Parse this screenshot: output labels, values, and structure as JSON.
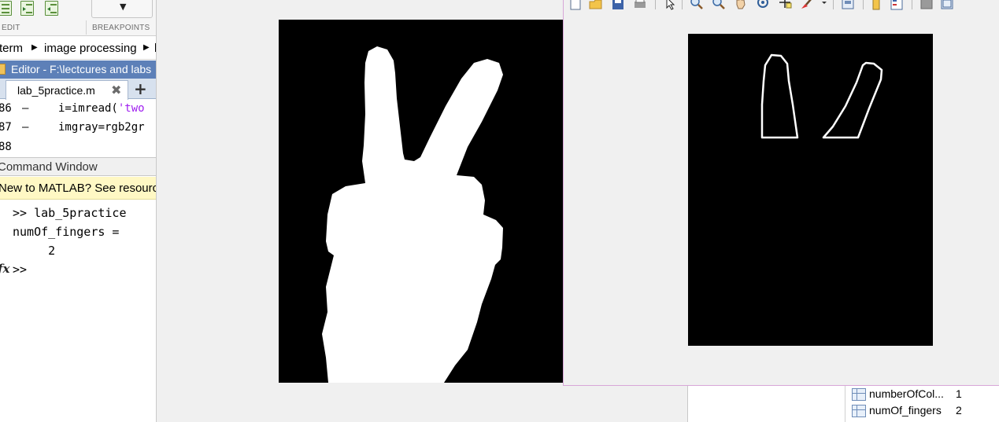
{
  "toolstrip": {
    "section_edit": "EDIT",
    "section_breakpoints": "BREAKPOINTS",
    "breakpoints_icon": "chevron-down-icon"
  },
  "address_bar": {
    "crumbs": [
      "term",
      "image processing",
      "labs"
    ]
  },
  "editor": {
    "title": "Editor - F:\\lectcures and labs",
    "tab_label": "lab_5practice.m",
    "tab_close": "✖",
    "add_tab": "+",
    "lines": [
      {
        "num": "86",
        "dash": "–",
        "code": "i=imread(",
        "str": "'two"
      },
      {
        "num": "87",
        "dash": "–",
        "code": "imgray=rgb2gr",
        "str": ""
      },
      {
        "num": "88",
        "dash": "",
        "code": "",
        "str": ""
      }
    ]
  },
  "command_window": {
    "title": "Command Window",
    "banner": "New to MATLAB? See resources",
    "output": [
      ">> lab_5practice",
      "numOf_fingers =",
      "     2",
      ">>"
    ],
    "fx_symbol": "fx"
  },
  "workspace": {
    "variables": [
      {
        "name": "numberOfCol...",
        "value": "1"
      },
      {
        "name": "numOf_fingers",
        "value": "2"
      }
    ]
  },
  "figure2": {
    "toolbar_icons": [
      "new-figure-icon",
      "open-file-icon",
      "save-icon",
      "print-icon",
      "select-arrow-icon",
      "zoom-in-icon",
      "zoom-out-icon",
      "pan-hand-icon",
      "rotate-3d-icon",
      "data-cursor-icon",
      "brush-icon",
      "link-plot-icon",
      "insert-colorbar-icon",
      "insert-legend-icon",
      "hide-plot-tools-icon",
      "show-plot-tools-icon"
    ]
  },
  "colors": {
    "editor_title_bg": "#5d80b8",
    "banner_bg": "#fff8c4",
    "string_color": "#a020f0",
    "figure_border": "#d8a6d8"
  }
}
